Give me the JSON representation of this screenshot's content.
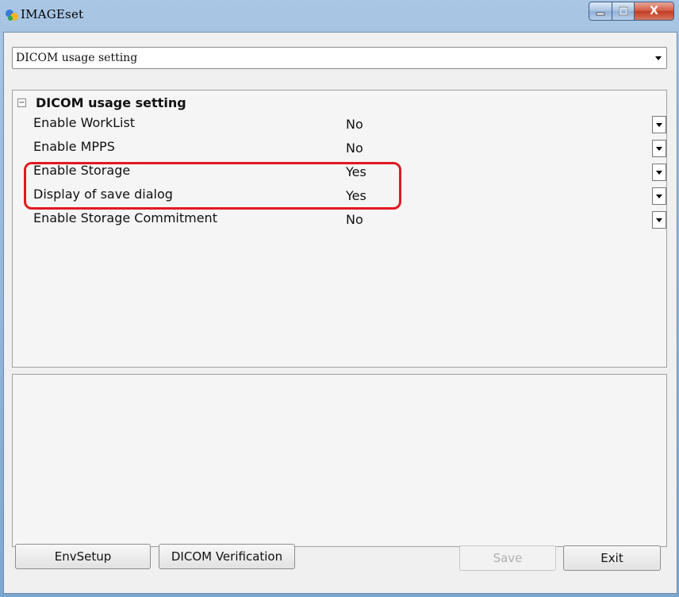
{
  "window": {
    "title": "IMAGEset",
    "close_glyph": "X"
  },
  "combo": {
    "selected": "DICOM usage setting"
  },
  "grid": {
    "category": "DICOM usage setting",
    "collapse_glyph": "−",
    "rows": [
      {
        "name": "Enable WorkList",
        "value": "No"
      },
      {
        "name": "Enable MPPS",
        "value": "No"
      },
      {
        "name": "Enable Storage",
        "value": "Yes"
      },
      {
        "name": "Display of save dialog",
        "value": "Yes"
      },
      {
        "name": "Enable Storage Commitment",
        "value": "No"
      }
    ]
  },
  "buttons": {
    "envsetup": "EnvSetup",
    "dicom_verification": "DICOM Verification",
    "save": "Save",
    "exit": "Exit"
  },
  "colors": {
    "highlight": "#e01a22",
    "title_bar": "#8fb4d6",
    "close_button": "#c13b22"
  }
}
